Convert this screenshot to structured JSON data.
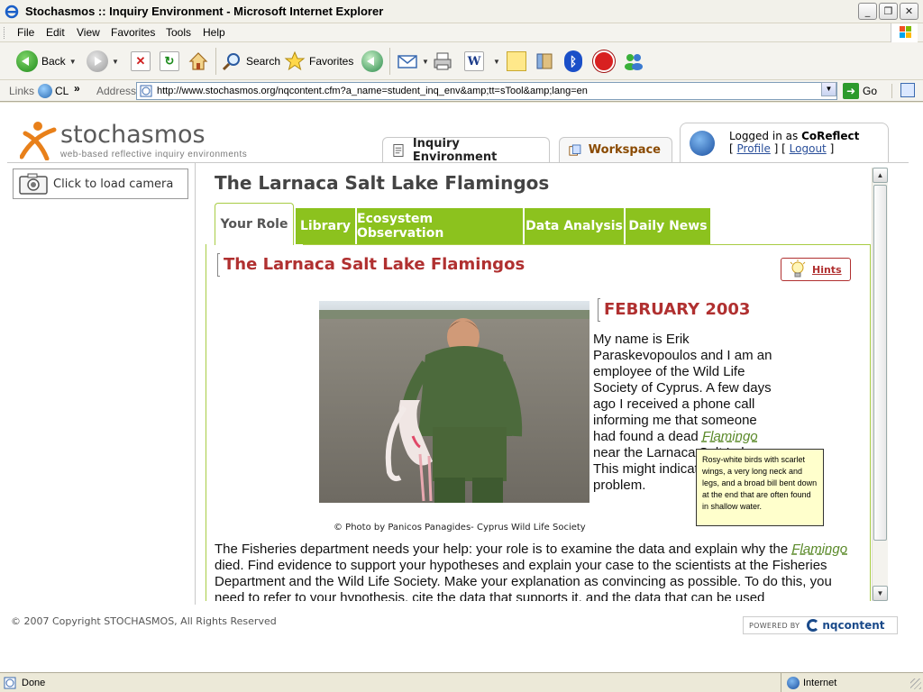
{
  "window": {
    "title": "Stochasmos :: Inquiry Environment - Microsoft Internet Explorer",
    "min_glyph": "_",
    "max_glyph": "❐",
    "close_glyph": "✕"
  },
  "menu": [
    "File",
    "Edit",
    "View",
    "Favorites",
    "Tools",
    "Help"
  ],
  "toolbar": {
    "back_label": "Back",
    "search_label": "Search",
    "favorites_label": "Favorites"
  },
  "address": {
    "links_label": "Links",
    "links_item": "CL",
    "chevron": "»",
    "label": "Address",
    "url": "http://www.stochasmos.org/nqcontent.cfm?a_name=student_inq_env&amp;tt=sTool&amp;lang=en",
    "go_label": "Go"
  },
  "site": {
    "logo_name": "stochasmos",
    "logo_tagline": "web-based reflective inquiry environments",
    "tab_inquiry": "Inquiry Environment",
    "tab_workspace": "Workspace",
    "logged_prefix": "Logged in as",
    "username": "CoReflect",
    "profile_link": "Profile",
    "logout_link": "Logout",
    "bracket_open": "[",
    "bracket_mid": "] [",
    "bracket_close": "]",
    "camera_label": "Click to load camera"
  },
  "content": {
    "page_title": "The Larnaca Salt Lake Flamingos",
    "subtabs": [
      "Your Role",
      "Library",
      "Ecosystem Observation",
      "Data Analysis",
      "Daily News"
    ],
    "heading": "The Larnaca Salt Lake Flamingos",
    "hints_label": "Hints",
    "date_heading": "FEBRUARY 2003",
    "side_text_1": "My name is Erik Paraskevopoulos and I am an employee of the Wild Life Society of Cyprus.  A few days ago I received a phone call informing me that someone had found a dead ",
    "side_gloss": "Flamingo",
    "side_text_2": " near the Larnaca Salt Lake. This might indicate a serious problem.",
    "photo_caption": "© Photo by Panicos Panagides- Cyprus Wild Life Society",
    "main_text_1": "The Fisheries department needs your help: your role is to examine the data and explain why the ",
    "main_gloss": "Flamingo",
    "main_text_2": " died. Find evidence to support your hypotheses and explain your case to the scientists at the Fisheries Department and the Wild Life Society.  Make your explanation as convincing as possible. To do this, you need to refer to your hypothesis, cite the data that supports it, and the data that can be used",
    "tooltip": "Rosy-white birds with scarlet wings, a very long neck and legs, and a broad bill bent down at the end that are often found in shallow water."
  },
  "footer": {
    "copyright": "© 2007 Copyright STOCHASMOS, All Rights Reserved",
    "powered_by": "POWERED BY",
    "powered_brand": "nqcontent"
  },
  "status": {
    "text": "Done",
    "zone": "Internet"
  },
  "scroll": {
    "up_glyph": "▲",
    "down_glyph": "▼"
  },
  "colors": {
    "accent_green": "#8cc21e",
    "heading_red": "#b03030",
    "brand_orange": "#e8801a"
  }
}
